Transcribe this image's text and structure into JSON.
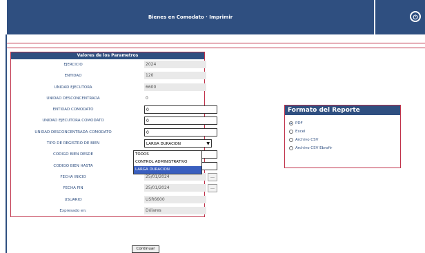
{
  "header": {
    "title": "Bienes en Comodato · Imprimir",
    "icon": "power-icon"
  },
  "params": {
    "heading": "Valores de los Parametros",
    "rows": [
      {
        "label": "EJERCICIO",
        "value": "2024",
        "kind": "readonly"
      },
      {
        "label": "ENTIDAD",
        "value": "120",
        "kind": "readonly"
      },
      {
        "label": "UNIDAD EJECUTORA",
        "value": "6600",
        "kind": "readonly"
      },
      {
        "label": "UNIDAD DESCONCENTRADA",
        "value": "0",
        "kind": "readonly"
      },
      {
        "label": "ENTIDAD COMODATO",
        "value": "0",
        "kind": "input"
      },
      {
        "label": "UNIDAD EJECUTORA COMODATO",
        "value": "0",
        "kind": "input"
      },
      {
        "label": "UNIDAD DESCONCENTRADA COMODATO",
        "value": "0",
        "kind": "input"
      },
      {
        "label": "TIPO DE REGISTRO DE BIEN",
        "value": "LARGA DURACION",
        "kind": "select"
      },
      {
        "label": "CODIGO BIEN DESDE",
        "value": "",
        "kind": "input"
      },
      {
        "label": "CODIGO BIEN HASTA",
        "value": "",
        "kind": "input"
      },
      {
        "label": "FECHA INICIO",
        "value": "25/01/2024",
        "kind": "date"
      },
      {
        "label": "FECHA FIN",
        "value": "25/01/2024",
        "kind": "date"
      },
      {
        "label": "USUARIO",
        "value": "USR6600",
        "kind": "readonly"
      },
      {
        "label": "Expresado en:",
        "value": "Dólares",
        "kind": "readonly"
      }
    ],
    "dropdown_options": [
      "TODOS",
      "CONTROL ADMINISTRATIVO",
      "LARGA DURACION"
    ],
    "dropdown_selected": "LARGA DURACION"
  },
  "format": {
    "heading": "Formato del Reporte",
    "options": [
      "PDF",
      "Excel",
      "Archivo CSV",
      "Archivo CSV Ebrofir"
    ],
    "selected": "PDF"
  },
  "actions": {
    "continue_label": "Continuar"
  },
  "colors": {
    "navy": "#2f4f80",
    "accent_red": "#c0324a"
  }
}
